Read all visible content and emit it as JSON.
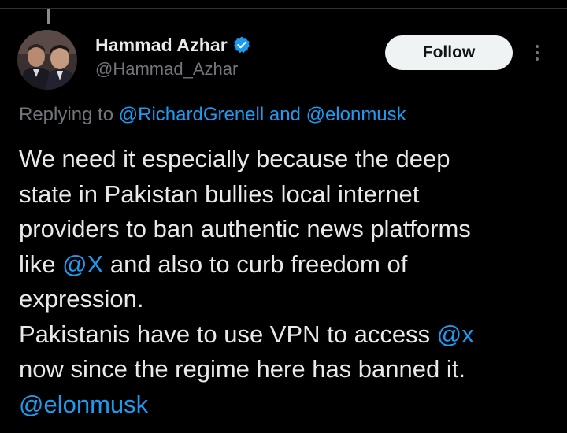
{
  "author": {
    "display_name": "Hammad Azhar",
    "handle": "@Hammad_Azhar",
    "verified": true
  },
  "actions": {
    "follow_label": "Follow",
    "more_icon": "more-vertical-icon"
  },
  "reply_context": {
    "prefix": "Replying to",
    "mention_1": "@RichardGrenell",
    "conjunction": "and",
    "mention_2": "@elonmusk"
  },
  "tweet": {
    "line1": "We need it especially because the deep",
    "line2": "state in Pakistan bullies local internet",
    "line3": "providers to ban authentic news platforms",
    "line4_pre": "like",
    "line4_mention": "@X",
    "line4_post": "and also to curb freedom of",
    "line5": "expression.",
    "line6_pre": "Pakistanis have to use VPN to access",
    "line6_mention": "@x",
    "line7": "now since the regime here has banned it.",
    "line8_mention": "@elonmusk"
  },
  "colors": {
    "background": "#000000",
    "text": "#e7e9ea",
    "secondary": "#71767b",
    "link": "#1d9bf0",
    "follow_bg": "#eff3f4"
  }
}
